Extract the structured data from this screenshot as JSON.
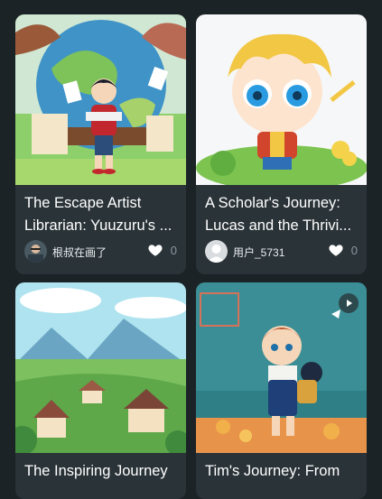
{
  "cards": [
    {
      "title": "The Escape Artist Librarian: Yuuzuru's ...",
      "user": "根叔在画了",
      "likes": "0",
      "avatar_icon": "user-photo-avatar",
      "theme": "#6bbf59"
    },
    {
      "title": "A Scholar's Journey: Lucas and the Thrivi...",
      "user": "用户_5731",
      "likes": "0",
      "avatar_icon": "default-user-avatar",
      "theme": "#f3f5f7"
    },
    {
      "title": "The Inspiring Journey",
      "user": "",
      "likes": "",
      "avatar_icon": "",
      "theme": "#7cc4de"
    },
    {
      "title": "Tim's Journey: From",
      "user": "",
      "likes": "",
      "avatar_icon": "",
      "theme": "#3a8a8f",
      "badge_icon": "play-icon"
    }
  ],
  "colors": {
    "background": "#1c2327",
    "card": "#2a3338",
    "text": "#ffffff",
    "muted": "#8d989e"
  }
}
